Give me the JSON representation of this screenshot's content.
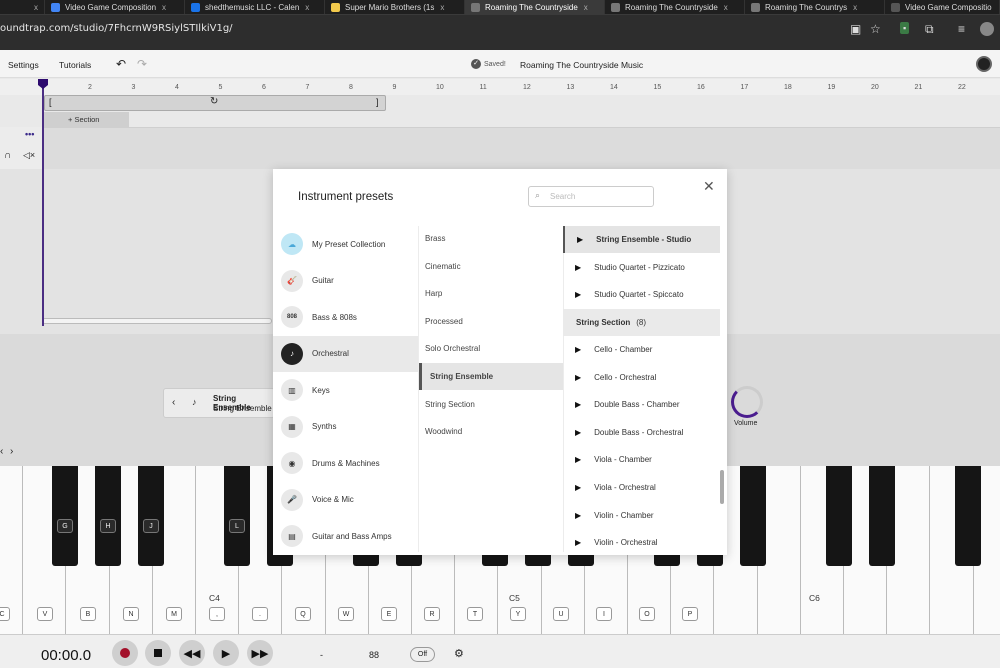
{
  "browser": {
    "tabs": [
      {
        "label": "",
        "close": "x",
        "color": "#1f1f1f"
      },
      {
        "label": "Video Game Composition",
        "close": "x",
        "color": "#4285f4"
      },
      {
        "label": "shedthemusic LLC - Calen",
        "close": "x",
        "color": "#1a73e8"
      },
      {
        "label": "Super Mario Brothers (1s",
        "close": "x",
        "color": "#f2c94c"
      },
      {
        "label": "Roaming The Countryside",
        "close": "x",
        "color": "#777"
      },
      {
        "label": "Roaming The Countryside",
        "close": "x",
        "color": "#777"
      },
      {
        "label": "Roaming The Countrys",
        "close": "x",
        "color": "#777"
      },
      {
        "label": "Video Game Compositio",
        "close": "",
        "color": "#555"
      }
    ],
    "url": "oundtrap.com/studio/7FhcrnW9RSiylSTIlkiV1g/"
  },
  "toolbar": {
    "settings": "Settings",
    "tutorials": "Tutorials",
    "saved": "Saved!",
    "project_title": "Roaming The Countryside Music"
  },
  "ruler": {
    "ticks": [
      "2",
      "3",
      "4",
      "5",
      "6",
      "7",
      "8",
      "9",
      "10",
      "11",
      "12",
      "13",
      "14",
      "15",
      "16",
      "17",
      "18",
      "19",
      "20",
      "21",
      "22"
    ]
  },
  "timeline": {
    "section_label": "+ Section",
    "more": "•••"
  },
  "instrument_pill": {
    "line1": "String Ensemble",
    "line2": "String Ensemble"
  },
  "volume_label": "Volume",
  "modal": {
    "title": "Instrument presets",
    "search_placeholder": "Search",
    "close": "✕",
    "categories": [
      {
        "label": "My Preset Collection",
        "icon": "cloud-icon",
        "glyph": "☁"
      },
      {
        "label": "Guitar",
        "icon": "guitar-icon",
        "glyph": "🎸"
      },
      {
        "label": "Bass & 808s",
        "icon": "bass-808-icon",
        "glyph": "808"
      },
      {
        "label": "Orchestral",
        "icon": "trumpet-icon",
        "glyph": "♪",
        "selected": true
      },
      {
        "label": "Keys",
        "icon": "keys-icon",
        "glyph": "▥"
      },
      {
        "label": "Synths",
        "icon": "synth-icon",
        "glyph": "▦"
      },
      {
        "label": "Drums & Machines",
        "icon": "drum-icon",
        "glyph": "◉"
      },
      {
        "label": "Voice & Mic",
        "icon": "mic-icon",
        "glyph": "🎤"
      },
      {
        "label": "Guitar and Bass Amps",
        "icon": "amp-icon",
        "glyph": "▤"
      }
    ],
    "subcategories": [
      {
        "label": "Brass"
      },
      {
        "label": "Cinematic"
      },
      {
        "label": "Harp"
      },
      {
        "label": "Processed"
      },
      {
        "label": "Solo Orchestral"
      },
      {
        "label": "String Ensemble",
        "selected": true
      },
      {
        "label": "String Section"
      },
      {
        "label": "Woodwind"
      }
    ],
    "presets_top": [
      {
        "label": "String Ensemble - Studio",
        "selected": true
      },
      {
        "label": "Studio Quartet - Pizzicato"
      },
      {
        "label": "Studio Quartet - Spiccato"
      }
    ],
    "group_header": "String Section",
    "group_count": "(8)",
    "presets_group": [
      {
        "label": "Cello - Chamber"
      },
      {
        "label": "Cello - Orchestral"
      },
      {
        "label": "Double Bass - Chamber"
      },
      {
        "label": "Double Bass - Orchestral"
      },
      {
        "label": "Viola - Chamber"
      },
      {
        "label": "Viola - Orchestral"
      },
      {
        "label": "Violin - Chamber"
      },
      {
        "label": "Violin - Orchestral"
      }
    ]
  },
  "piano": {
    "white_labels": [
      "C",
      "V",
      "B",
      "N",
      "M",
      ",",
      ".",
      "Q",
      "W",
      "E",
      "R",
      "T",
      "Y",
      "U",
      "I",
      "O",
      "P"
    ],
    "black_labels": [
      "G",
      "H",
      "J",
      "L"
    ],
    "octaves": [
      "C4",
      "C5",
      "C6"
    ]
  },
  "transport": {
    "time": "00:00.0",
    "tempo": "88",
    "metronome": "Off",
    "dash": "-"
  }
}
